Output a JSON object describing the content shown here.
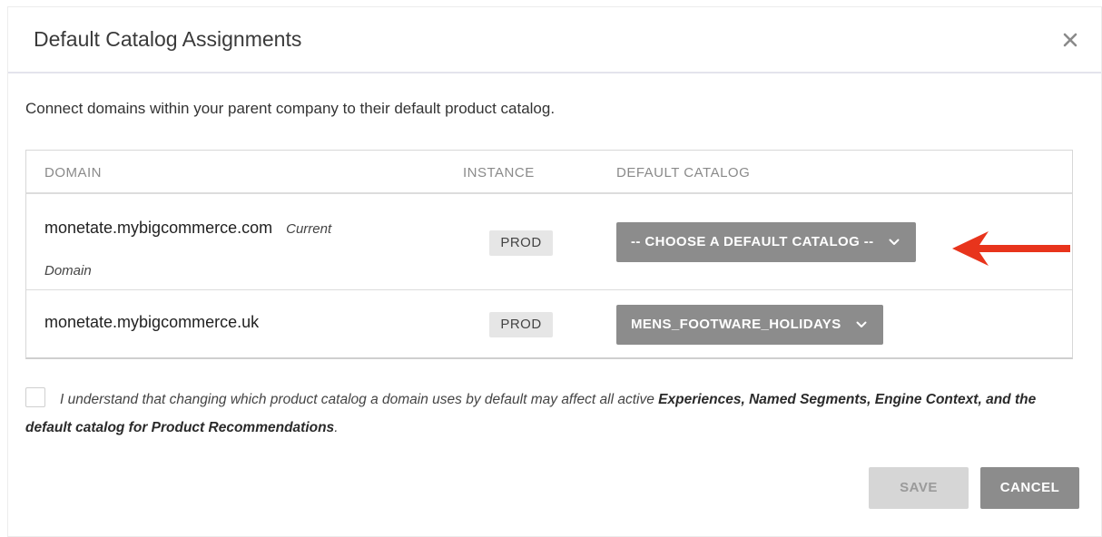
{
  "modal": {
    "title": "Default Catalog Assignments",
    "close_icon": "close-icon",
    "description": "Connect domains within your parent company to their default product catalog."
  },
  "table": {
    "headers": {
      "domain": "DOMAIN",
      "instance": "INSTANCE",
      "default_catalog": "DEFAULT CATALOG"
    },
    "rows": [
      {
        "domain": "monetate.mybigcommerce.com",
        "note_part1": "Current",
        "note_part2": "Domain",
        "instance": "PROD",
        "catalog": "-- CHOOSE A DEFAULT CATALOG --"
      },
      {
        "domain": "monetate.mybigcommerce.uk",
        "instance": "PROD",
        "catalog": "MENS_FOOTWARE_HOLIDAYS"
      }
    ]
  },
  "acknowledgement": {
    "checked": false,
    "text_prefix": "I understand that changing which product catalog a domain uses by default may affect all active ",
    "bold_experiences": "Experiences, Named Segments, Engine Context,",
    "text_middle": " ",
    "bold_default": "and the default catalog for Product Recommendations",
    "text_suffix": "."
  },
  "buttons": {
    "save": "SAVE",
    "cancel": "CANCEL"
  },
  "colors": {
    "dropdown_bg": "#8c8c8c",
    "arrow": "#e8341c",
    "save_disabled_bg": "#d6d6d6",
    "cancel_bg": "#8c8c8c"
  }
}
